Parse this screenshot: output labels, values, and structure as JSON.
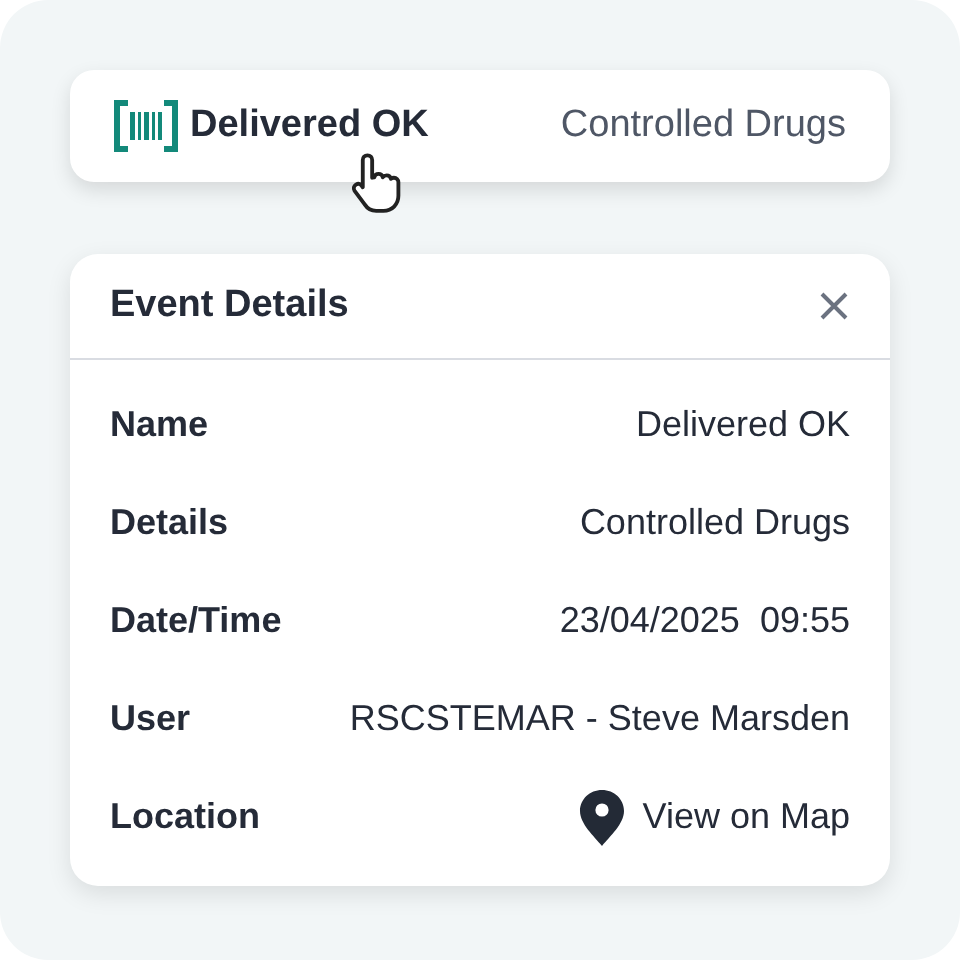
{
  "event_bar": {
    "name": "Delivered OK",
    "details": "Controlled Drugs"
  },
  "panel": {
    "title": "Event Details",
    "rows": [
      {
        "label": "Name",
        "value": "Delivered OK",
        "kind": "text"
      },
      {
        "label": "Details",
        "value": "Controlled Drugs",
        "kind": "text"
      },
      {
        "label": "Date/Time",
        "value": "23/04/2025  09:55",
        "kind": "text"
      },
      {
        "label": "User",
        "value": "RSCSTEMAR - Steve Marsden",
        "kind": "text"
      },
      {
        "label": "Location",
        "value": "View on Map",
        "kind": "link"
      }
    ]
  }
}
